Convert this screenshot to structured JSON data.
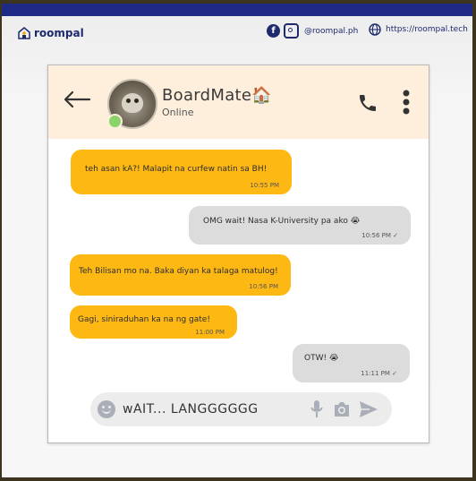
{
  "brand": {
    "name": "roompal"
  },
  "social": {
    "handle": "@roompal.ph",
    "website": "https://roompal.tech"
  },
  "chat": {
    "contact_name": "BoardMate🏠",
    "contact_status": "Online",
    "messages": [
      {
        "direction": "in",
        "text": "teh asan kA?! Malapit na curfew natin sa BH!",
        "time": "10:55 PM"
      },
      {
        "direction": "out",
        "text": "OMG wait! Nasa K-University pa ako 😭",
        "time": "10:56 PM ✓"
      },
      {
        "direction": "in",
        "text": "Teh Bilisan mo na. Baka diyan ka talaga matulog!",
        "time": "10:56 PM"
      },
      {
        "direction": "in",
        "text": "Gagi, siniraduhan ka na ng gate!",
        "time": "11:00 PM"
      },
      {
        "direction": "out",
        "text": "OTW! 😭",
        "time": "11:11 PM ✓"
      }
    ]
  },
  "composer": {
    "value": "wAIT... LANGGGGGG"
  },
  "colors": {
    "incoming": "#fdb813",
    "outgoing": "#dcdcdc",
    "header": "#fdefdc",
    "brand": "#1f2a6e"
  },
  "icons": [
    "house-logo-icon",
    "facebook-icon",
    "instagram-icon",
    "globe-icon",
    "back-arrow-icon",
    "phone-icon",
    "more-vertical-icon",
    "emoji-icon",
    "microphone-icon",
    "camera-icon",
    "send-icon"
  ]
}
